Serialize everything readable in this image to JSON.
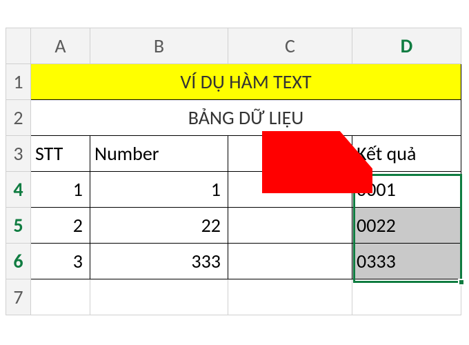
{
  "columns": {
    "A": "A",
    "B": "B",
    "C": "C",
    "D": "D"
  },
  "rows": {
    "1": "1",
    "2": "2",
    "3": "3",
    "4": "4",
    "5": "5",
    "6": "6",
    "7": "7"
  },
  "title": "VÍ DỤ HÀM TEXT",
  "subtitle": "BẢNG DỮ LIỆU",
  "headers": {
    "stt": "STT",
    "number": "Number",
    "result": "Kết quả"
  },
  "data": [
    {
      "stt": "1",
      "number": "1",
      "result": "0001"
    },
    {
      "stt": "2",
      "number": "22",
      "result": "0022"
    },
    {
      "stt": "3",
      "number": "333",
      "result": "0333"
    }
  ],
  "chart_data": {
    "type": "table",
    "title": "VÍ DỤ HÀM TEXT — BẢNG DỮ LIỆU",
    "columns": [
      "STT",
      "Number",
      "Kết quả"
    ],
    "rows": [
      [
        1,
        1,
        "0001"
      ],
      [
        2,
        22,
        "0022"
      ],
      [
        3,
        333,
        "0333"
      ]
    ]
  }
}
